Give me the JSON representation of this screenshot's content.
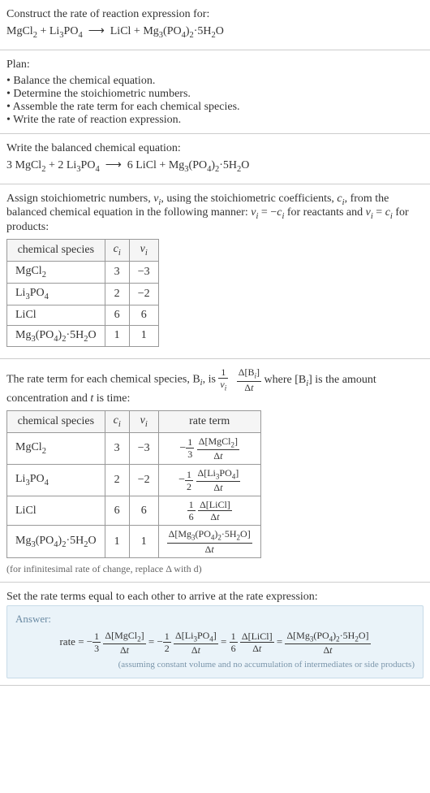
{
  "header": {
    "title": "Construct the rate of reaction expression for:",
    "equation_html": "MgCl<sub>2</sub> + Li<sub>3</sub>PO<sub>4</sub> &nbsp;⟶&nbsp; LiCl + Mg<sub>3</sub>(PO<sub>4</sub>)<sub>2</sub>·5H<sub>2</sub>O"
  },
  "plan": {
    "title": "Plan:",
    "items": [
      "Balance the chemical equation.",
      "Determine the stoichiometric numbers.",
      "Assemble the rate term for each chemical species.",
      "Write the rate of reaction expression."
    ]
  },
  "balanced": {
    "title": "Write the balanced chemical equation:",
    "equation_html": "3 MgCl<sub>2</sub> + 2 Li<sub>3</sub>PO<sub>4</sub> &nbsp;⟶&nbsp; 6 LiCl + Mg<sub>3</sub>(PO<sub>4</sub>)<sub>2</sub>·5H<sub>2</sub>O"
  },
  "stoich": {
    "intro_html": "Assign stoichiometric numbers, <i>ν<sub>i</sub></i>, using the stoichiometric coefficients, <i>c<sub>i</sub></i>, from the balanced chemical equation in the following manner: <i>ν<sub>i</sub></i> = −<i>c<sub>i</sub></i> for reactants and <i>ν<sub>i</sub></i> = <i>c<sub>i</sub></i> for products:",
    "headers": [
      "chemical species",
      "c_i",
      "ν_i"
    ],
    "headers_html": [
      "chemical species",
      "<i>c<sub>i</sub></i>",
      "<i>ν<sub>i</sub></i>"
    ],
    "rows": [
      {
        "species_html": "MgCl<sub>2</sub>",
        "c": "3",
        "nu": "−3"
      },
      {
        "species_html": "Li<sub>3</sub>PO<sub>4</sub>",
        "c": "2",
        "nu": "−2"
      },
      {
        "species_html": "LiCl",
        "c": "6",
        "nu": "6"
      },
      {
        "species_html": "Mg<sub>3</sub>(PO<sub>4</sub>)<sub>2</sub>·5H<sub>2</sub>O",
        "c": "1",
        "nu": "1"
      }
    ]
  },
  "rate_terms": {
    "intro_prefix": "The rate term for each chemical species, B",
    "intro_mid": ", is ",
    "intro_frac1_num": "1",
    "intro_frac1_den_html": "<i>ν<sub>i</sub></i>",
    "intro_frac2_num_html": "Δ[B<sub><i>i</i></sub>]",
    "intro_frac2_den_html": "Δ<i>t</i>",
    "intro_suffix_html": " where [B<sub><i>i</i></sub>] is the amount concentration and <i>t</i> is time:",
    "headers_html": [
      "chemical species",
      "<i>c<sub>i</sub></i>",
      "<i>ν<sub>i</sub></i>",
      "rate term"
    ],
    "rows": [
      {
        "species_html": "MgCl<sub>2</sub>",
        "c": "3",
        "nu": "−3",
        "sign": "−",
        "coef_num": "1",
        "coef_den": "3",
        "d_num_html": "Δ[MgCl<sub>2</sub>]",
        "d_den_html": "Δ<i>t</i>"
      },
      {
        "species_html": "Li<sub>3</sub>PO<sub>4</sub>",
        "c": "2",
        "nu": "−2",
        "sign": "−",
        "coef_num": "1",
        "coef_den": "2",
        "d_num_html": "Δ[Li<sub>3</sub>PO<sub>4</sub>]",
        "d_den_html": "Δ<i>t</i>"
      },
      {
        "species_html": "LiCl",
        "c": "6",
        "nu": "6",
        "sign": "",
        "coef_num": "1",
        "coef_den": "6",
        "d_num_html": "Δ[LiCl]",
        "d_den_html": "Δ<i>t</i>"
      },
      {
        "species_html": "Mg<sub>3</sub>(PO<sub>4</sub>)<sub>2</sub>·5H<sub>2</sub>O",
        "c": "1",
        "nu": "1",
        "sign": "",
        "coef_num": "",
        "coef_den": "",
        "d_num_html": "Δ[Mg<sub>3</sub>(PO<sub>4</sub>)<sub>2</sub>·5H<sub>2</sub>O]",
        "d_den_html": "Δ<i>t</i>"
      }
    ],
    "note": "(for infinitesimal rate of change, replace Δ with d)"
  },
  "final": {
    "title": "Set the rate terms equal to each other to arrive at the rate expression:",
    "answer_label": "Answer:",
    "rate_prefix": "rate = ",
    "note": "(assuming constant volume and no accumulation of intermediates or side products)"
  },
  "chart_data": {
    "type": "table",
    "tables": [
      {
        "title": "Stoichiometric numbers",
        "columns": [
          "chemical species",
          "c_i",
          "nu_i"
        ],
        "rows": [
          [
            "MgCl2",
            3,
            -3
          ],
          [
            "Li3PO4",
            2,
            -2
          ],
          [
            "LiCl",
            6,
            6
          ],
          [
            "Mg3(PO4)2·5H2O",
            1,
            1
          ]
        ]
      },
      {
        "title": "Rate terms",
        "columns": [
          "chemical species",
          "c_i",
          "nu_i",
          "rate term"
        ],
        "rows": [
          [
            "MgCl2",
            3,
            -3,
            "-(1/3) Δ[MgCl2]/Δt"
          ],
          [
            "Li3PO4",
            2,
            -2,
            "-(1/2) Δ[Li3PO4]/Δt"
          ],
          [
            "LiCl",
            6,
            6,
            "(1/6) Δ[LiCl]/Δt"
          ],
          [
            "Mg3(PO4)2·5H2O",
            1,
            1,
            "Δ[Mg3(PO4)2·5H2O]/Δt"
          ]
        ]
      }
    ],
    "rate_expression": "rate = -(1/3) Δ[MgCl2]/Δt = -(1/2) Δ[Li3PO4]/Δt = (1/6) Δ[LiCl]/Δt = Δ[Mg3(PO4)2·5H2O]/Δt"
  }
}
